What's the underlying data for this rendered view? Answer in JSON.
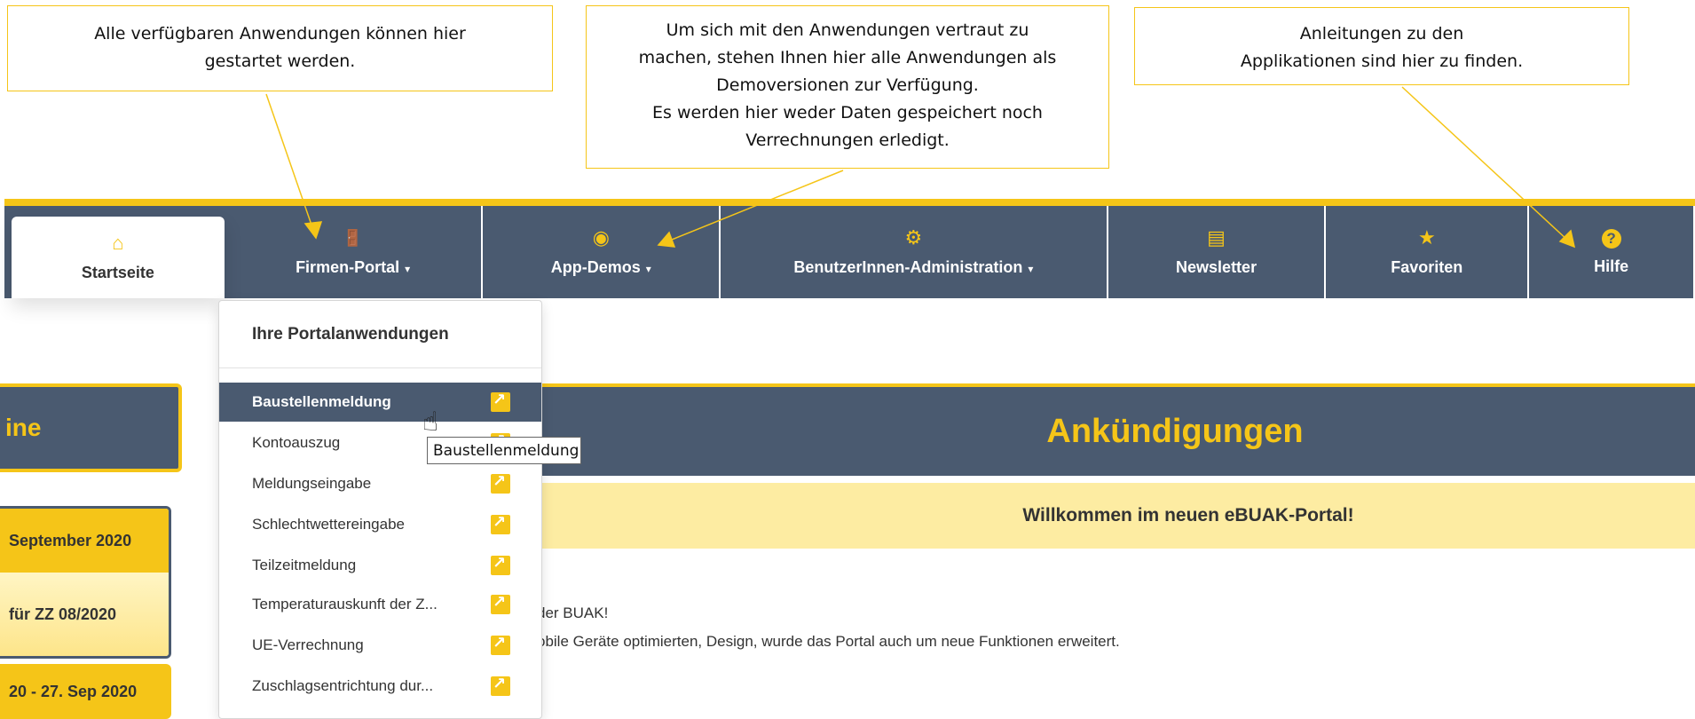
{
  "callouts": {
    "left": [
      "Alle verfügbaren Anwendungen können hier",
      "gestartet werden."
    ],
    "middle": [
      "Um sich mit den Anwendungen vertraut zu",
      "machen, stehen Ihnen hier alle Anwendungen als",
      "Demoversionen zur Verfügung.",
      "Es werden hier weder Daten gespeichert noch",
      "Verrechnungen erledigt."
    ],
    "right": [
      "Anleitungen zu den",
      "Applikationen sind hier zu finden."
    ]
  },
  "nav": {
    "items": [
      {
        "label": "Startseite",
        "icon": "home-icon",
        "glyph": "⌂"
      },
      {
        "label": "Firmen-Portal",
        "icon": "door-icon",
        "glyph": "🚪",
        "caret": "▾"
      },
      {
        "label": "App-Demos",
        "icon": "eye-icon",
        "glyph": "◉",
        "caret": "▾"
      },
      {
        "label": "BenutzerInnen-Administration",
        "icon": "users-gear-icon",
        "glyph": "⚙",
        "caret": "▾"
      },
      {
        "label": "Newsletter",
        "icon": "newspaper-icon",
        "glyph": "▤"
      },
      {
        "label": "Favoriten",
        "icon": "star-icon",
        "glyph": "★"
      },
      {
        "label": "Hilfe",
        "icon": "question-icon",
        "glyph": "?"
      }
    ]
  },
  "dropdown": {
    "header": "Ihre Portalanwendungen",
    "items": [
      "Baustellenmeldung",
      "Kontoauszug",
      "Meldungseingabe",
      "Schlechtwettereingabe",
      "Teilzeitmeldung",
      "Temperaturauskunft der Z...",
      "UE-Verrechnung",
      "Zuschlagsentrichtung dur..."
    ]
  },
  "tooltip": "Baustellenmeldung",
  "main": {
    "title": "Ankündigungen",
    "welcome": "Willkommen im neuen eBUAK-Portal!",
    "line1": "der BUAK!",
    "line2": "obile Geräte optimierten, Design, wurde das Portal auch um neue Funktionen erweitert."
  },
  "sidebar": {
    "title": "ine",
    "card1_head": "September 2020",
    "card1_body": "für ZZ 08/2020",
    "card2_head": "20 - 27. Sep 2020"
  },
  "colors": {
    "accent": "#f5c518",
    "nav": "#4a5a70",
    "welcome_bg": "#fdeca2"
  }
}
